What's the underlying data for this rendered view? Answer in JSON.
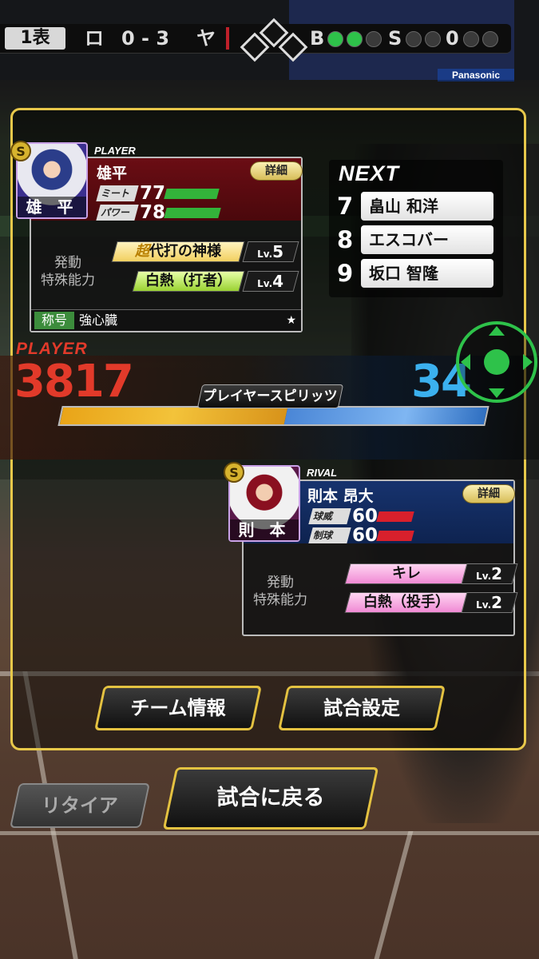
{
  "scoreboard": {
    "inning": "1表",
    "away_team": "ロ",
    "score": "0 - 3",
    "home_team": "ヤ",
    "balls_label": "B",
    "strikes_label": "S",
    "outs": "0",
    "balls": 2,
    "strikes": 0,
    "sponsor": "Panasonic"
  },
  "player": {
    "tag": "PLAYER",
    "rank_badge": "S",
    "name": "雄平",
    "avatar_name": "雄 平",
    "detail_label": "詳細",
    "stats": [
      {
        "label": "ミート",
        "value": "77",
        "fill": 0.77
      },
      {
        "label": "パワー",
        "value": "78",
        "fill": 0.78
      }
    ],
    "ability_header": "発動\n特殊能力",
    "abilities": [
      {
        "prefix": "超",
        "name": "代打の神様",
        "lv_prefix": "Lv.",
        "lv": "5"
      },
      {
        "prefix": "",
        "name": "白熱（打者）",
        "lv_prefix": "Lv.",
        "lv": "4"
      }
    ],
    "title_label": "称号",
    "title_value": "強心臓",
    "title_mark": "★"
  },
  "next": {
    "title": "NEXT",
    "batters": [
      {
        "num": "7",
        "name": "畠山 和洋"
      },
      {
        "num": "8",
        "name": "エスコバー"
      },
      {
        "num": "9",
        "name": "坂口 智隆"
      }
    ]
  },
  "spirits": {
    "player_label": "PLAYER",
    "player_score": "3817",
    "rival_score": "34",
    "label": "プレイヤースピリッツ",
    "player_share": 0.53
  },
  "rival": {
    "tag": "RIVAL",
    "rank_badge": "S",
    "name": "則本 昂大",
    "avatar_name": "則 本",
    "detail_label": "詳細",
    "stats": [
      {
        "label": "球威",
        "value": "60",
        "fill": 0.6
      },
      {
        "label": "制球",
        "value": "60",
        "fill": 0.6
      }
    ],
    "ability_header": "発動\n特殊能力",
    "abilities": [
      {
        "name": "キレ",
        "lv_prefix": "Lv.",
        "lv": "2"
      },
      {
        "name": "白熱（投手）",
        "lv_prefix": "Lv.",
        "lv": "2"
      }
    ]
  },
  "buttons": {
    "team_info": "チーム情報",
    "match_settings": "試合設定",
    "retire": "リタイア",
    "back_to_game": "試合に戻る"
  },
  "colors": {
    "frame_gold": "#e7c84a",
    "player_red": "#e23a2a",
    "rival_blue": "#3bb0ee",
    "stat_green": "#33b33a",
    "stat_red": "#d8202c",
    "dpad_green": "#2ec24a"
  },
  "icons": [
    "dpad-icon",
    "star-icon",
    "rank-s-icon"
  ]
}
